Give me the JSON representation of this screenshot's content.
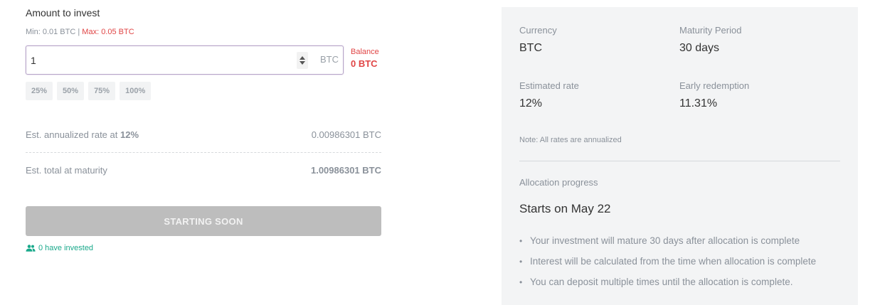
{
  "form": {
    "amount_label": "Amount to invest",
    "limits": {
      "min": "Min: 0.01 BTC",
      "separator": " | ",
      "max": "Max: 0.05 BTC"
    },
    "input_value": "1",
    "unit": "BTC",
    "balance_label": "Balance",
    "balance_value": "0 BTC",
    "percent_buttons": [
      "25%",
      "50%",
      "75%",
      "100%"
    ],
    "rate_row": {
      "label_prefix": "Est. annualized rate at ",
      "label_rate": "12%",
      "value": "0.00986301 BTC"
    },
    "total_row": {
      "label": "Est. total at maturity",
      "value": "1.00986301 BTC"
    },
    "button_label": "STARTING SOON",
    "invested_text": "0 have invested",
    "invested_icon": "people-icon",
    "accent_color": "#1aa98b",
    "error_color": "#e04545"
  },
  "panel": {
    "currency_label": "Currency",
    "currency_value": "BTC",
    "maturity_label": "Maturity Period",
    "maturity_value": "30 days",
    "rate_label": "Estimated rate",
    "rate_value": "12%",
    "early_label": "Early redemption",
    "early_value": "11.31%",
    "note": "Note: All rates are annualized",
    "allocation_label": "Allocation progress",
    "starts": "Starts on May 22",
    "bullets": [
      "Your investment will mature 30 days after allocation is complete",
      "Interest will be calculated from the time when allocation is complete",
      "You can deposit multiple times until the allocation is complete."
    ]
  }
}
